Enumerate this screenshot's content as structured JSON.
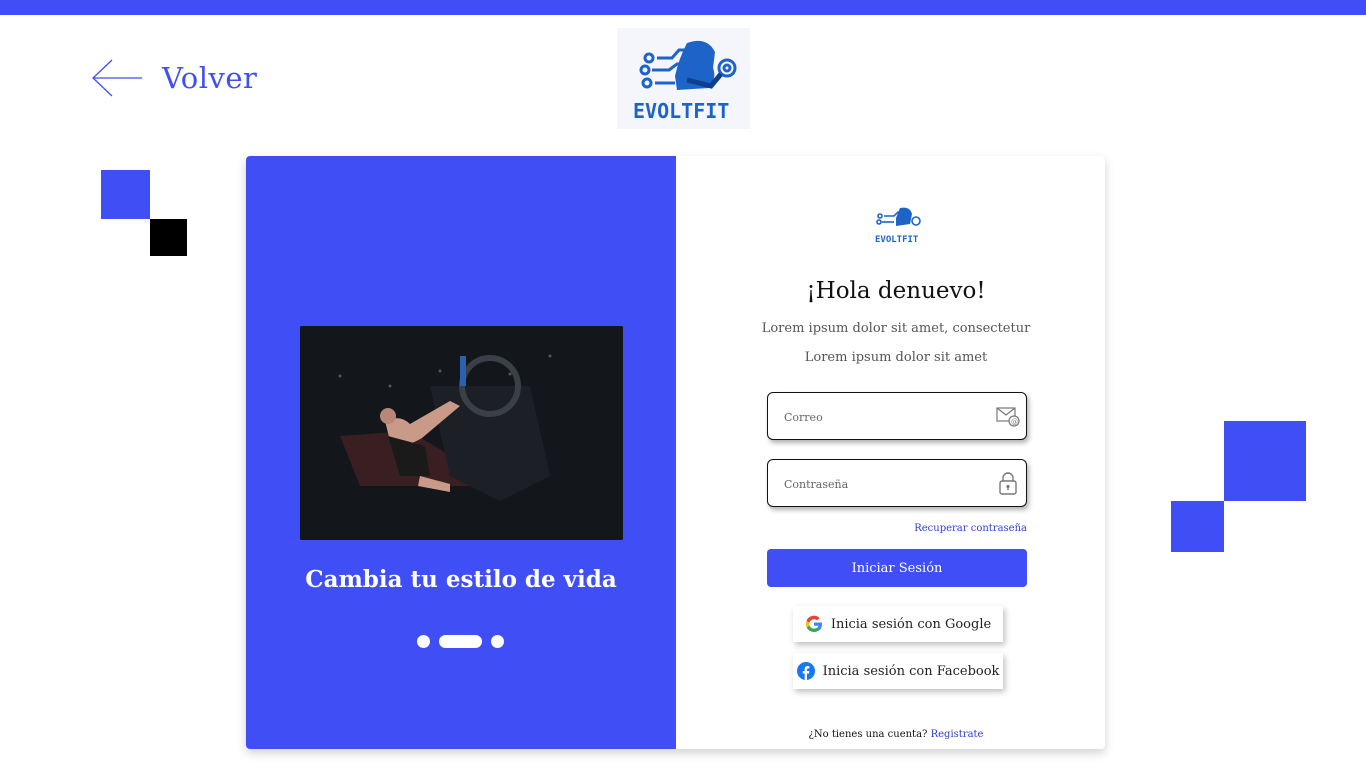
{
  "nav": {
    "back_label": "Volver"
  },
  "brand": {
    "logo_text": "EVOLTFIT",
    "accent": "#3f4ff5"
  },
  "hero": {
    "slogan": "Cambia tu estilo de vida",
    "carousel": {
      "count": 3,
      "active_index": 1
    }
  },
  "login": {
    "title": "¡Hola denuevo!",
    "subtitle_line1": "Lorem ipsum dolor sit amet, consectetur",
    "subtitle_line2": "Lorem ipsum dolor sit amet",
    "email_placeholder": "Correo",
    "password_placeholder": "Contraseña",
    "forgot_label": "Recuperar contraseña",
    "submit_label": "Iniciar Sesión",
    "google_label": "Inicia sesión con Google",
    "facebook_label": "Inicia sesión con Facebook",
    "no_account_text": "¿No tienes una cuenta?",
    "register_label": "Registrate"
  },
  "icons": {
    "back": "arrow-left-icon",
    "email": "mail-icon",
    "password": "lock-icon",
    "google": "google-icon",
    "facebook": "facebook-icon"
  }
}
